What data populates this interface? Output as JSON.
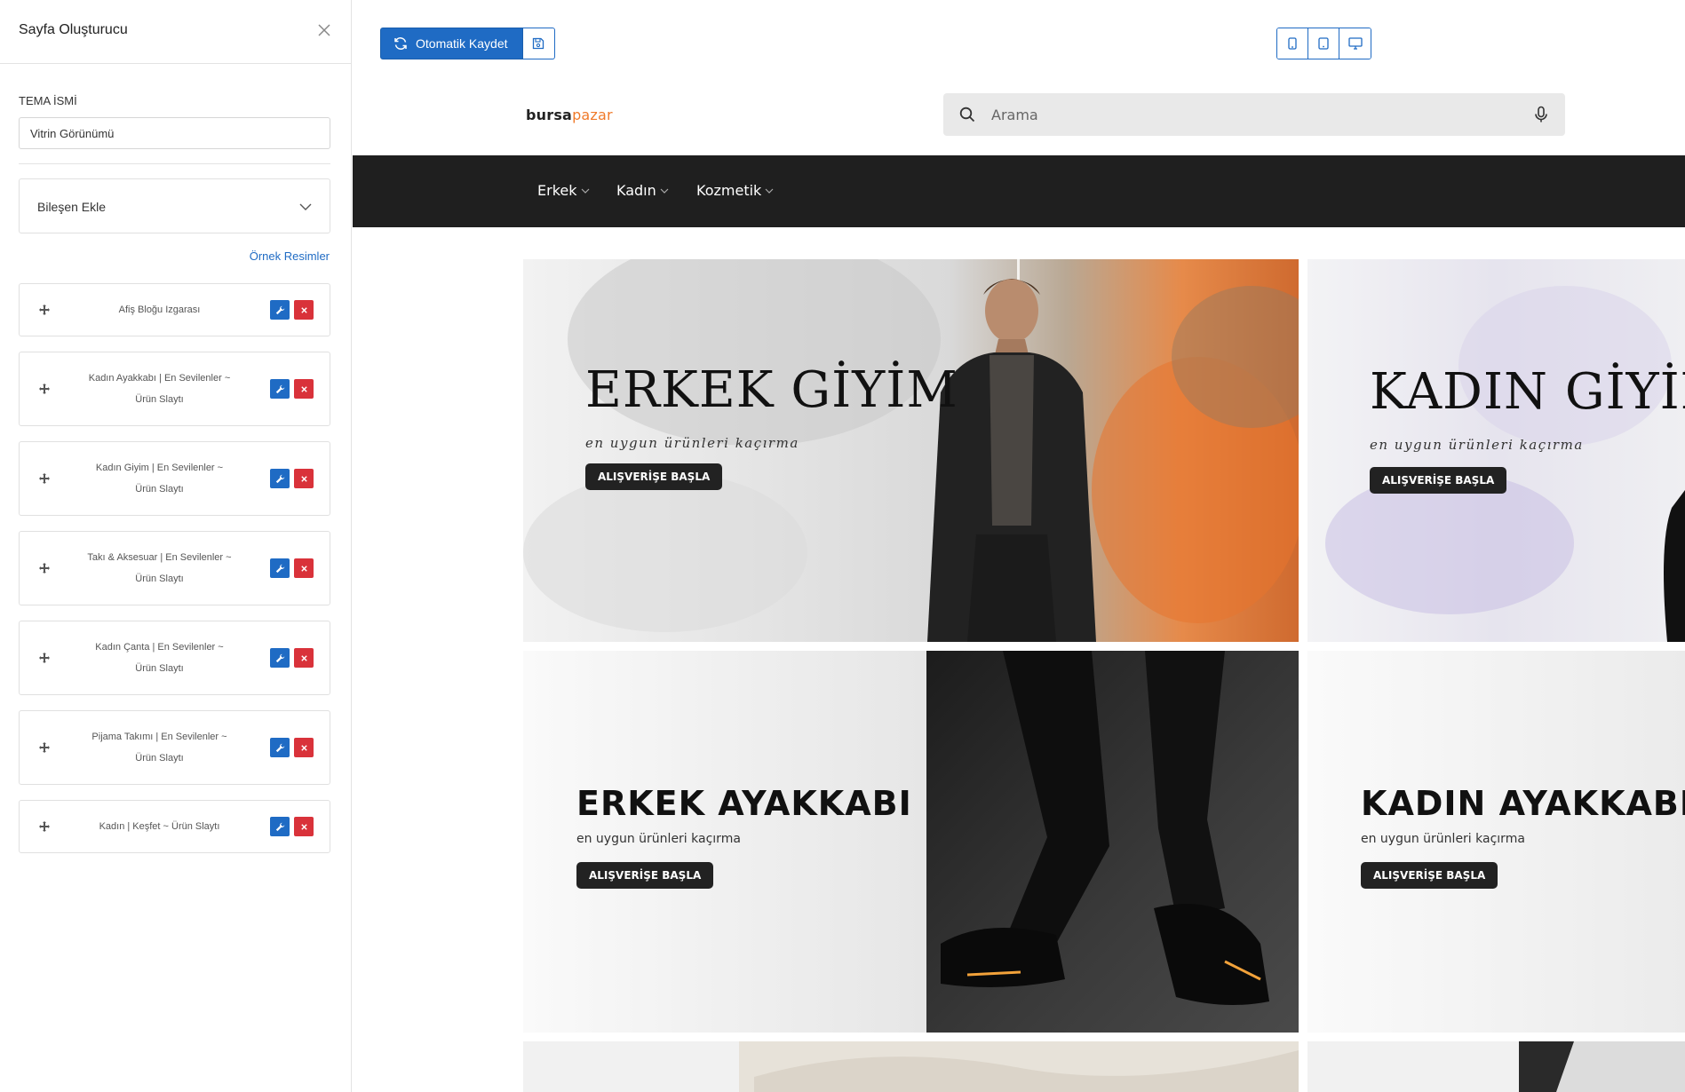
{
  "sidebar": {
    "title": "Sayfa Oluşturucu",
    "theme_label": "TEMA İSMİ",
    "theme_value": "Vitrin Görünümü",
    "add_component": "Bileşen Ekle",
    "sample_images": "Örnek Resimler",
    "components": [
      {
        "label": "Afiş Bloğu Izgarası"
      },
      {
        "label": "Kadın Ayakkabı | En Sevilenler ~ Ürün Slaytı"
      },
      {
        "label": "Kadın Giyim | En Sevilenler ~ Ürün Slaytı"
      },
      {
        "label": "Takı & Aksesuar | En Sevilenler ~ Ürün Slaytı"
      },
      {
        "label": "Kadın Çanta | En Sevilenler ~ Ürün Slaytı"
      },
      {
        "label": "Pijama Takımı | En Sevilenler ~ Ürün Slaytı"
      },
      {
        "label": "Kadın | Keşfet ~ Ürün Slaytı"
      }
    ]
  },
  "toolbar": {
    "autosave_label": "Otomatik Kaydet"
  },
  "store": {
    "logo_part1": "bursa",
    "logo_part2": "pazar",
    "search_placeholder": "Arama",
    "nav": [
      {
        "label": "Erkek"
      },
      {
        "label": "Kadın"
      },
      {
        "label": "Kozmetik"
      }
    ],
    "banners": [
      {
        "title": "ERKEK GİYİM",
        "subtitle": "en uygun ürünleri kaçırma",
        "button": "ALIŞVERİŞE BAŞLA"
      },
      {
        "title": "KADIN GİYİM",
        "subtitle": "en uygun ürünleri kaçırma",
        "button": "ALIŞVERİŞE BAŞLA"
      },
      {
        "title": "ERKEK AYAKKABI",
        "subtitle": "en uygun ürünleri kaçırma",
        "button": "ALIŞVERİŞE BAŞLA"
      },
      {
        "title": "KADIN AYAKKABI",
        "subtitle": "en uygun ürünleri kaçırma",
        "button": "ALIŞVERİŞE BAŞLA"
      }
    ]
  },
  "colors": {
    "accent": "#1f6bc4",
    "danger": "#d9323a",
    "nav_bg": "#1f1f1f",
    "logo_accent": "#f07a2a"
  },
  "icons": [
    "close-icon",
    "chevron-down-icon",
    "move-icon",
    "wrench-icon",
    "delete-icon",
    "refresh-icon",
    "save-icon",
    "mobile-icon",
    "tablet-icon",
    "desktop-icon",
    "search-icon",
    "microphone-icon"
  ]
}
